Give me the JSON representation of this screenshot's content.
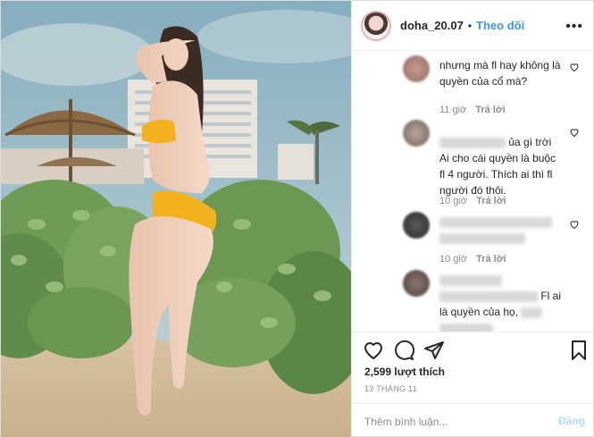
{
  "header": {
    "username": "doha_20.07",
    "separator": "•",
    "follow_label": "Theo dõi"
  },
  "comments": [
    {
      "lines": [
        "nhưng mà fl hay không là",
        "quyền của cổ mà?"
      ],
      "time": "11 giờ",
      "reply": "Trả lời"
    },
    {
      "lines": [
        "ủa gì trời",
        "Ai cho cái quyền là buộc",
        "fl 4 người. Thích ai thì fl",
        "người đó thôi."
      ],
      "time": "10 giờ",
      "reply": "Trả lời"
    },
    {
      "lines": [],
      "time": "10 giờ",
      "reply": "Trả lời"
    },
    {
      "lines": [
        "Fl ai",
        "là quyền của họ,"
      ],
      "time": "",
      "reply": ""
    }
  ],
  "actions": {
    "likes": "2,599 lượt thích",
    "date": "13 THÁNG 11"
  },
  "add_comment": {
    "placeholder": "Thêm bình luận...",
    "post_label": "Đăng"
  },
  "icons": [
    "like-icon",
    "comment-icon",
    "share-icon",
    "save-icon",
    "more-options-icon"
  ],
  "colors": {
    "link_blue": "#3897f0",
    "post_disabled": "#b2dffc",
    "meta_gray": "#8e8e8e",
    "swimsuit": "#f2b21e"
  }
}
